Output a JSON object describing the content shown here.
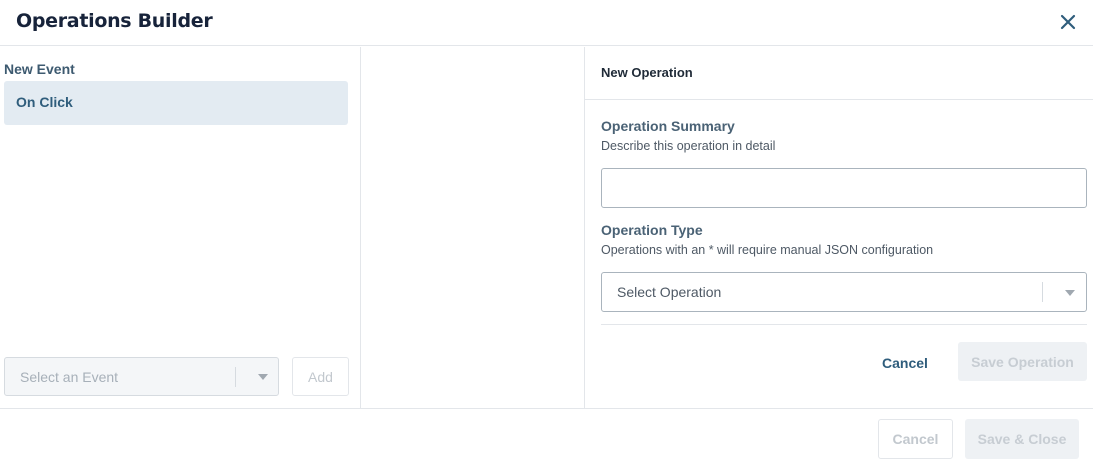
{
  "header": {
    "title": "Operations Builder",
    "close_icon": "close-icon"
  },
  "events_panel": {
    "section_label": "New Event",
    "items": [
      {
        "label": "On Click",
        "selected": true
      }
    ],
    "event_select": {
      "placeholder": "Select an Event",
      "icon": "chevron-down-icon"
    },
    "add_label": "Add"
  },
  "operation_panel": {
    "header_title": "New Operation",
    "summary": {
      "label": "Operation Summary",
      "help": "Describe this operation in detail",
      "value": ""
    },
    "type": {
      "label": "Operation Type",
      "help": "Operations with an * will require manual JSON configuration",
      "placeholder": "Select Operation",
      "icon": "chevron-down-icon"
    },
    "cancel_label": "Cancel",
    "save_label": "Save Operation"
  },
  "footer": {
    "cancel_label": "Cancel",
    "save_close_label": "Save & Close"
  },
  "colors": {
    "accent": "#2f5d7c",
    "title": "#17233a",
    "selected_bg": "#e3ebf2",
    "disabled_text": "#c7cdd3"
  }
}
